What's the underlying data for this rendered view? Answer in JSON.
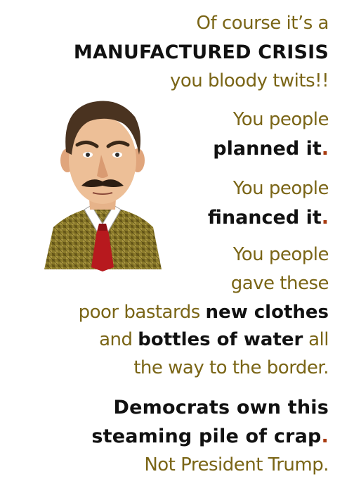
{
  "lines": {
    "l1": "Of course it’s a",
    "l2": "MANUFACTURED CRISIS",
    "l3": "you bloody twits!!",
    "l4": "You people",
    "l5": "planned it",
    "l6": "You people",
    "l7": "financed it",
    "l8": "You people",
    "l9": "gave these",
    "l10a": "poor bastards ",
    "l10b": "new clothes",
    "l11a": "and ",
    "l11b": "bottles of water",
    "l11c": " all",
    "l12": "the way to the border.",
    "l13": "Democrats own this",
    "l14": "steaming pile of crap",
    "l15": "Not President Trump."
  },
  "punct": {
    "period": "."
  },
  "colors": {
    "olive": "#7a6516",
    "black": "#111111",
    "accent_period": "#a83b10"
  }
}
